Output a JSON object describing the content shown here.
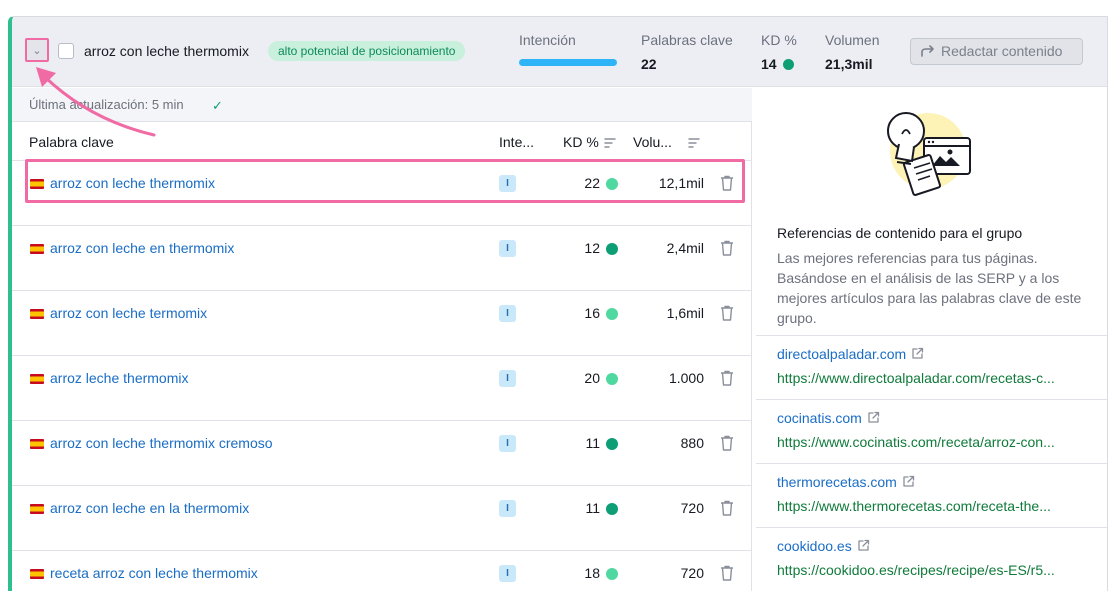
{
  "group": {
    "title": "arroz con leche thermomix",
    "badge": "alto potencial de posicionamiento",
    "metrics": {
      "intent_label": "Intención",
      "keywords_label": "Palabras clave",
      "keywords_value": "22",
      "kd_label": "KD %",
      "kd_value": "14",
      "volume_label": "Volumen",
      "volume_value": "21,3mil"
    },
    "draft_button": "Redactar contenido"
  },
  "updated": "Última actualización: 5 min",
  "table": {
    "headers": {
      "keyword": "Palabra clave",
      "intent": "Inte...",
      "kd": "KD %",
      "volume": "Volu..."
    },
    "rows": [
      {
        "keyword": "arroz con leche thermomix",
        "intent": "I",
        "kd": "22",
        "kd_color": "#4fd8a0",
        "volume": "12,1mil"
      },
      {
        "keyword": "arroz con leche en thermomix",
        "intent": "I",
        "kd": "12",
        "kd_color": "#0e9e75",
        "volume": "2,4mil"
      },
      {
        "keyword": "arroz con leche termomix",
        "intent": "I",
        "kd": "16",
        "kd_color": "#4fd8a0",
        "volume": "1,6mil"
      },
      {
        "keyword": "arroz leche thermomix",
        "intent": "I",
        "kd": "20",
        "kd_color": "#4fd8a0",
        "volume": "1.000"
      },
      {
        "keyword": "arroz con leche thermomix cremoso",
        "intent": "I",
        "kd": "11",
        "kd_color": "#0e9e75",
        "volume": "880"
      },
      {
        "keyword": "arroz con leche en la thermomix",
        "intent": "I",
        "kd": "11",
        "kd_color": "#0e9e75",
        "volume": "720"
      },
      {
        "keyword": "receta arroz con leche thermomix",
        "intent": "I",
        "kd": "18",
        "kd_color": "#4fd8a0",
        "volume": "720"
      }
    ]
  },
  "references": {
    "title": "Referencias de contenido para el grupo",
    "description": "Las mejores referencias para tus páginas. Basándose en el análisis de las SERP y a los mejores artículos para las palabras clave de este grupo.",
    "items": [
      {
        "domain": "directoalpaladar.com",
        "url": "https://www.directoalpaladar.com/recetas-c..."
      },
      {
        "domain": "cocinatis.com",
        "url": "https://www.cocinatis.com/receta/arroz-con..."
      },
      {
        "domain": "thermorecetas.com",
        "url": "https://www.thermorecetas.com/receta-the..."
      },
      {
        "domain": "cookidoo.es",
        "url": "https://cookidoo.es/recipes/recipe/es-ES/r5..."
      }
    ]
  },
  "colors": {
    "accent_green": "#2fbf8f",
    "highlight_pink": "#f06ba4",
    "link_blue": "#1a6dc5",
    "url_green": "#0f7a3a",
    "intent_bar": "#2fb5f7"
  }
}
